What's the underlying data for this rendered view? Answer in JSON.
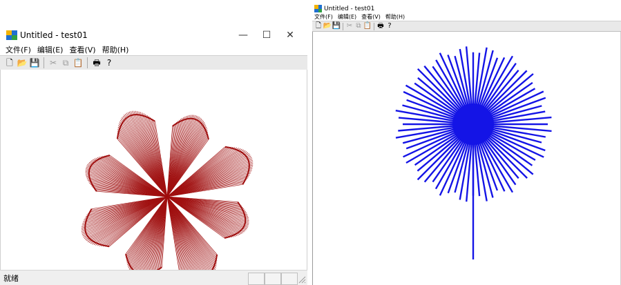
{
  "window1": {
    "title": "Untitled - test01",
    "caption_buttons": {
      "minimize": "—",
      "maximize": "☐",
      "close": "✕"
    },
    "menu": [
      "文件(F)",
      "编辑(E)",
      "查看(V)",
      "帮助(H)"
    ],
    "toolbar": {
      "new_icon": "🗋",
      "open_icon": "📂",
      "save_icon": "💾",
      "cut_icon": "✂",
      "copy_icon": "⧉",
      "paste_icon": "📋",
      "print_icon": "🖶",
      "help_icon": "?"
    },
    "status_text": "就绪",
    "drawing": {
      "stroke_color": "#a01010",
      "petals": 8
    }
  },
  "window2": {
    "title": "Untitled - test01",
    "menu": [
      "文件(F)",
      "编辑(E)",
      "查看(V)",
      "帮助(H)"
    ],
    "toolbar": {
      "new_icon": "🗋",
      "open_icon": "📂",
      "save_icon": "💾",
      "cut_icon": "✂",
      "copy_icon": "⧉",
      "paste_icon": "📋",
      "print_icon": "🖶",
      "help_icon": "?"
    },
    "drawing": {
      "stroke_color": "#1414e6",
      "ray_count": 72
    }
  }
}
